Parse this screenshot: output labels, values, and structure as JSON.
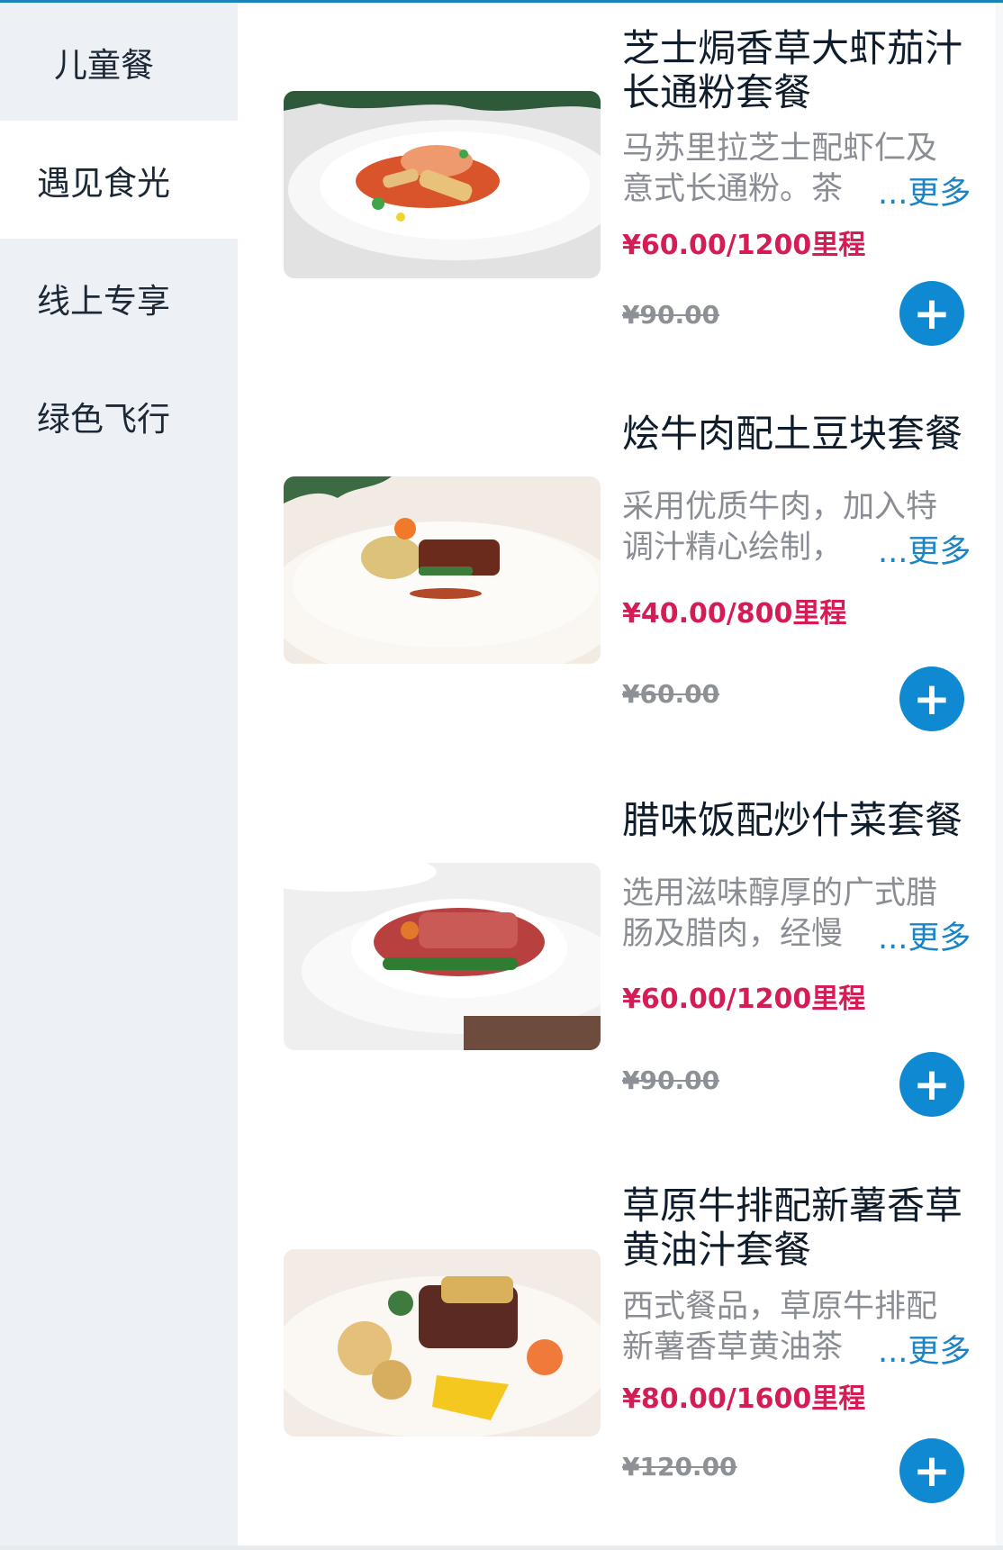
{
  "sidebar": {
    "items": [
      {
        "label": "儿童餐"
      },
      {
        "label": "遇见食光"
      },
      {
        "label": "线上专享"
      },
      {
        "label": "绿色飞行"
      }
    ]
  },
  "products": [
    {
      "title": "芝士焗香草大虾茄汁长通粉套餐",
      "description": "马苏里拉芝士配虾仁及意式长通粉。茶",
      "more_label": "...更多",
      "price": "¥60.00/1200里程",
      "original_price": "¥90.00",
      "add_icon": "+"
    },
    {
      "title": "烩牛肉配土豆块套餐",
      "description": "采用优质牛肉，加入特调汁精心绘制，",
      "more_label": "...更多",
      "price": "¥40.00/800里程",
      "original_price": "¥60.00",
      "add_icon": "+"
    },
    {
      "title": "腊味饭配炒什菜套餐",
      "description": "选用滋味醇厚的广式腊肠及腊肉，经慢",
      "more_label": "...更多",
      "price": "¥60.00/1200里程",
      "original_price": "¥90.00",
      "add_icon": "+"
    },
    {
      "title": "草原牛排配新薯香草黄油汁套餐",
      "description": "西式餐品，草原牛排配新薯香草黄油茶",
      "more_label": "...更多",
      "price": "¥80.00/1600里程",
      "original_price": "¥120.00",
      "add_icon": "+"
    }
  ],
  "colors": {
    "accent": "#0f8ad2",
    "price": "#d41d55",
    "sidebar_bg": "#edf1f5",
    "more_link": "#1a84c6"
  },
  "icons": {
    "add": "plus-icon"
  }
}
